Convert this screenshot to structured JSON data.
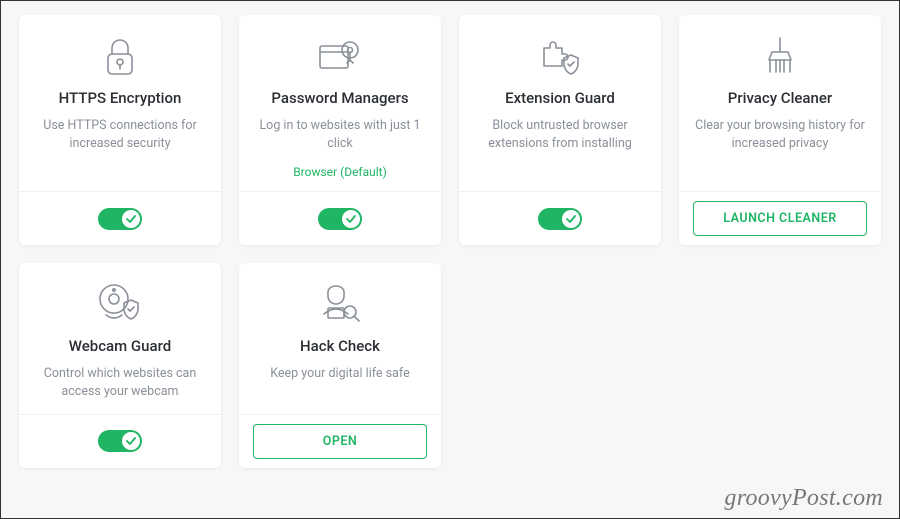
{
  "cards": [
    {
      "icon": "lock-icon",
      "title": "HTTPS Encryption",
      "desc": "Use HTTPS connections for increased security",
      "sub": "",
      "action": {
        "type": "toggle",
        "on": true
      }
    },
    {
      "icon": "password-icon",
      "title": "Password Managers",
      "desc": "Log in to websites with just 1 click",
      "sub": "Browser (Default)",
      "action": {
        "type": "toggle",
        "on": true
      }
    },
    {
      "icon": "extension-icon",
      "title": "Extension Guard",
      "desc": "Block untrusted browser extensions from installing",
      "sub": "",
      "action": {
        "type": "toggle",
        "on": true
      }
    },
    {
      "icon": "brush-icon",
      "title": "Privacy Cleaner",
      "desc": "Clear your browsing history for increased privacy",
      "sub": "",
      "action": {
        "type": "button",
        "label": "LAUNCH CLEANER"
      }
    },
    {
      "icon": "webcam-icon",
      "title": "Webcam Guard",
      "desc": "Control which websites can access your webcam",
      "sub": "",
      "action": {
        "type": "toggle",
        "on": true
      }
    },
    {
      "icon": "hacker-icon",
      "title": "Hack Check",
      "desc": "Keep your digital life safe",
      "sub": "",
      "action": {
        "type": "button",
        "label": "OPEN"
      }
    }
  ],
  "watermark": "groovyPost.com"
}
